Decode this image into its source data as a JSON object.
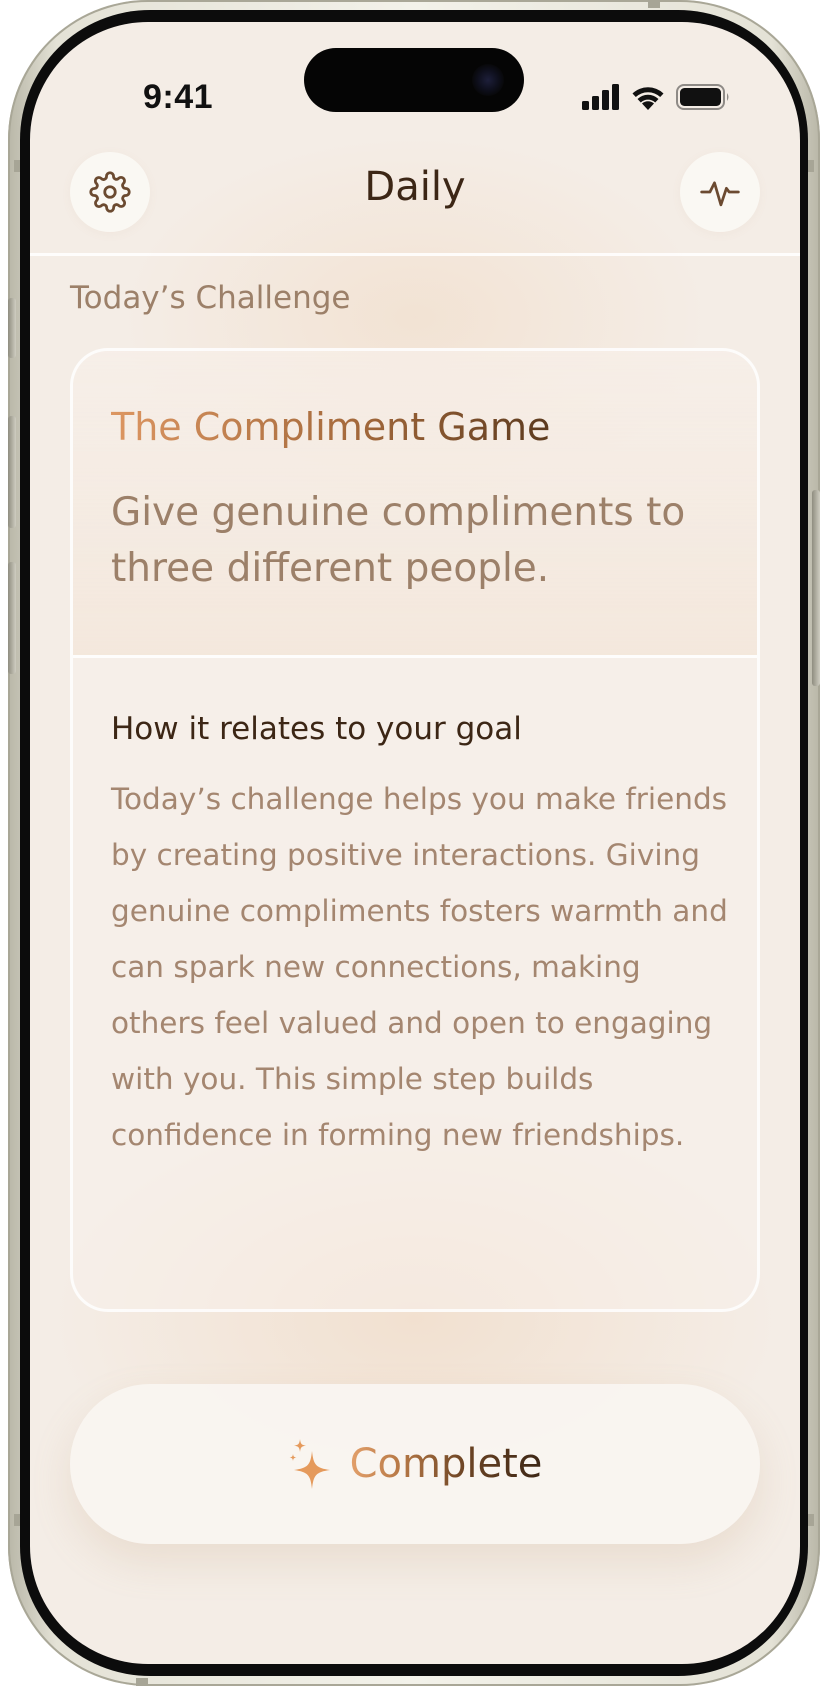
{
  "status_bar": {
    "time": "9:41"
  },
  "header": {
    "title": "Daily",
    "left_icon": "gear-icon",
    "right_icon": "activity-pulse-icon"
  },
  "challenge": {
    "section_label": "Today’s Challenge",
    "title": "The Compliment Game",
    "description": "Give genuine compliments to three different people.",
    "relates_heading": "How it relates to your goal",
    "relates_body": "Today’s challenge helps you make friends by creating positive interactions. Giving genuine compliments fosters warmth and can spark new connections, making others feel valued and open to engaging with you. This simple step builds confidence in forming new friendships."
  },
  "action": {
    "complete_label": "Complete",
    "icon": "sparkle-icon"
  },
  "colors": {
    "background": "#f4ede6",
    "text_dark": "#3c2615",
    "text_muted": "#9c8069",
    "accent": "#e59a5c"
  }
}
